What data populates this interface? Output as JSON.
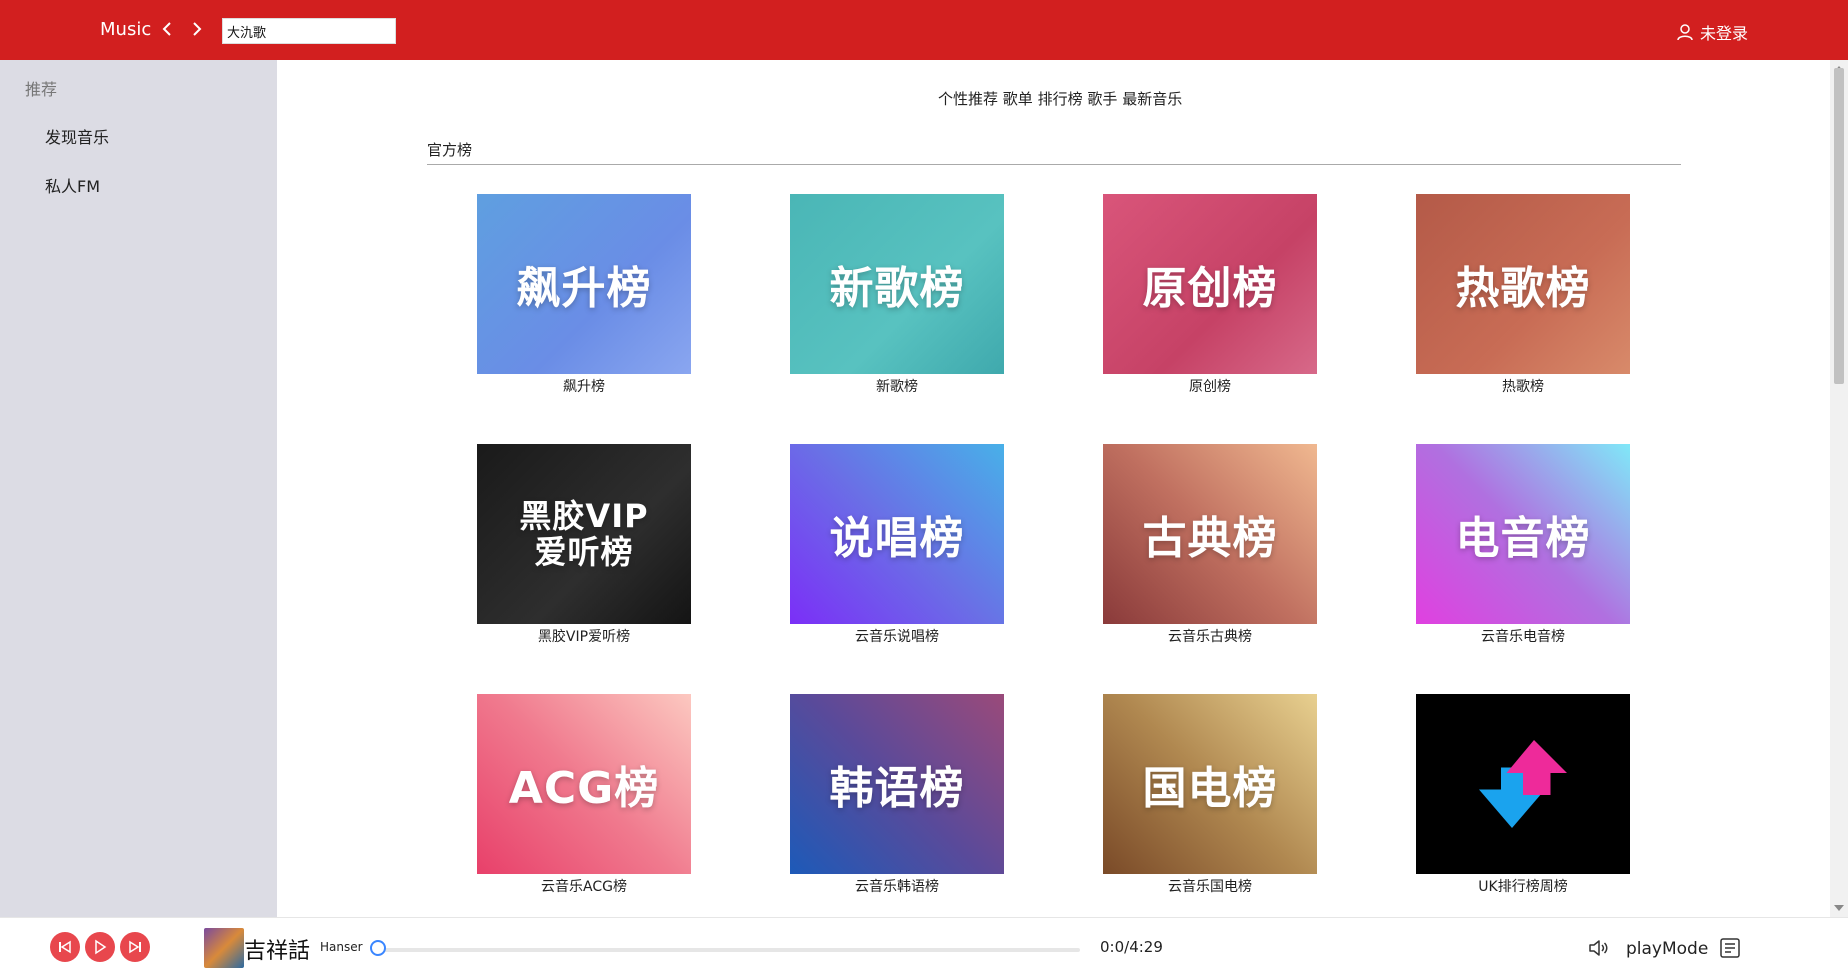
{
  "header": {
    "brand": "Music",
    "search_value": "大氿歌",
    "user_label": "未登录"
  },
  "sidebar": {
    "group_label": "推荐",
    "items": [
      {
        "label": "发现音乐"
      },
      {
        "label": "私人FM"
      }
    ]
  },
  "tabs": [
    "个性推荐",
    "歌单",
    "排行榜",
    "歌手",
    "最新音乐"
  ],
  "section": {
    "title": "官方榜"
  },
  "charts": [
    {
      "cover_text": "飙升榜",
      "label": "飙升榜",
      "bg": "linear-gradient(135deg,#5f9fe0,#6a8de6 60%,#8aa6f0)"
    },
    {
      "cover_text": "新歌榜",
      "label": "新歌榜",
      "bg": "linear-gradient(135deg,#4ab6b6,#58c2c0 60%,#3fa9ad)"
    },
    {
      "cover_text": "原创榜",
      "label": "原创榜",
      "bg": "linear-gradient(135deg,#d9557a,#c64266 60%,#d76989)"
    },
    {
      "cover_text": "热歌榜",
      "label": "热歌榜",
      "bg": "linear-gradient(135deg,#b45a48,#c86c55 60%,#d88a6a)"
    },
    {
      "cover_text": "黑胶VIP 爱听榜",
      "label": "黑胶VIP爱听榜",
      "bg": "linear-gradient(135deg,#1a1a1a,#2e2e2e 60%,#141414)"
    },
    {
      "cover_text": "说唱榜",
      "label": "云音乐说唱榜",
      "bg": "linear-gradient(45deg,#7b2ff7,#6a6fe6 50%,#48b0e8)"
    },
    {
      "cover_text": "古典榜",
      "label": "云音乐古典榜",
      "bg": "linear-gradient(45deg,#8a3a3a,#c07060 50%,#f0b890)"
    },
    {
      "cover_text": "电音榜",
      "label": "云音乐电音榜",
      "bg": "linear-gradient(45deg,#e040e0,#b070e0 50%,#80e8f8)"
    },
    {
      "cover_text": "ACG榜",
      "label": "云音乐ACG榜",
      "bg": "linear-gradient(45deg,#e8406a,#f07a8e 50%,#fcc8c0)"
    },
    {
      "cover_text": "韩语榜",
      "label": "云音乐韩语榜",
      "bg": "linear-gradient(45deg,#1d5ab8,#5a4a9a 50%,#9a4a7a)"
    },
    {
      "cover_text": "国电榜",
      "label": "云音乐国电榜",
      "bg": "linear-gradient(45deg,#7a4a28,#b08850 50%,#e8d090)"
    },
    {
      "cover_text": "",
      "label": "UK排行榜周榜",
      "bg": "#000000"
    }
  ],
  "player": {
    "song_title": "吉祥話",
    "artist": "Hanser",
    "time": "0:0/4:29",
    "progress": 0,
    "play_mode_label": "playMode"
  },
  "colors": {
    "header_bg": "#d21f1f",
    "sidebar_bg": "#dcdce4",
    "player_button": "#e8474d",
    "progress_knob": "#3a86ff"
  },
  "icons": {
    "prev": "chevron-left-icon",
    "next": "chevron-right-icon",
    "user": "user-icon",
    "skip_back": "skip-back-icon",
    "play": "play-icon",
    "skip_forward": "skip-forward-icon",
    "volume": "volume-icon",
    "playlist": "playlist-icon"
  }
}
